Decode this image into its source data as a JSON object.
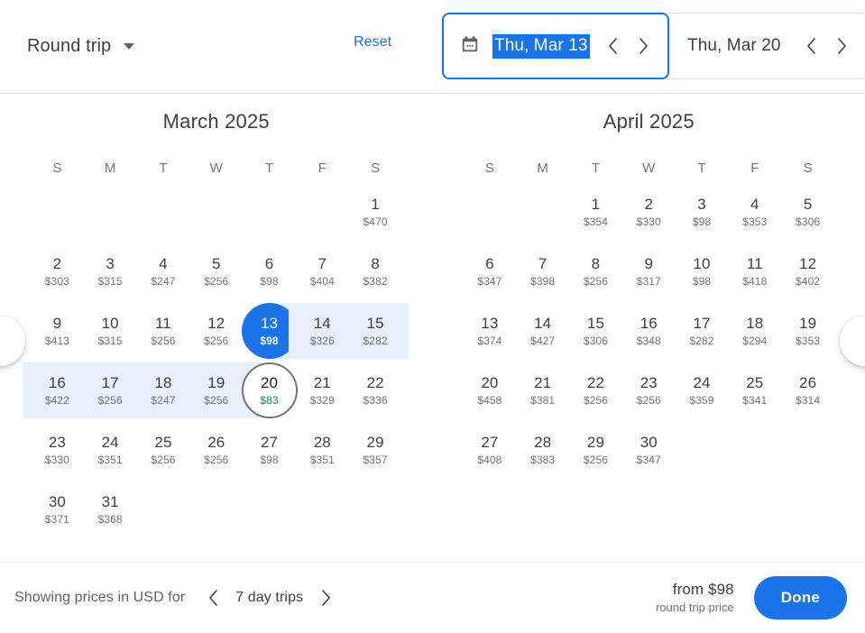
{
  "header": {
    "trip_type": "Round trip",
    "reset_label": "Reset",
    "depart": {
      "value": "Thu, Mar 13",
      "icon": "calendar-icon"
    },
    "return": {
      "value": "Thu, Mar 20"
    },
    "prev_icon": "chevron-left-icon",
    "next_icon": "chevron-right-icon"
  },
  "weekdays": [
    "S",
    "M",
    "T",
    "W",
    "T",
    "F",
    "S"
  ],
  "months": [
    {
      "title": "March 2025",
      "lead_blanks": 6,
      "days": [
        {
          "day": "1",
          "price": "$470"
        },
        {
          "day": "2",
          "price": "$303"
        },
        {
          "day": "3",
          "price": "$315"
        },
        {
          "day": "4",
          "price": "$247"
        },
        {
          "day": "5",
          "price": "$256"
        },
        {
          "day": "6",
          "price": "$98"
        },
        {
          "day": "7",
          "price": "$404"
        },
        {
          "day": "8",
          "price": "$382"
        },
        {
          "day": "9",
          "price": "$413"
        },
        {
          "day": "10",
          "price": "$315"
        },
        {
          "day": "11",
          "price": "$256"
        },
        {
          "day": "12",
          "price": "$256"
        },
        {
          "day": "13",
          "price": "$98",
          "state": "selected-start"
        },
        {
          "day": "14",
          "price": "$326",
          "state": "in-range"
        },
        {
          "day": "15",
          "price": "$282",
          "state": "in-range"
        },
        {
          "day": "16",
          "price": "$422",
          "state": "in-range"
        },
        {
          "day": "17",
          "price": "$256",
          "state": "in-range"
        },
        {
          "day": "18",
          "price": "$247",
          "state": "in-range"
        },
        {
          "day": "19",
          "price": "$256",
          "state": "in-range"
        },
        {
          "day": "20",
          "price": "$83",
          "state": "selected-end",
          "price_low": true
        },
        {
          "day": "21",
          "price": "$329"
        },
        {
          "day": "22",
          "price": "$336"
        },
        {
          "day": "23",
          "price": "$330"
        },
        {
          "day": "24",
          "price": "$351"
        },
        {
          "day": "25",
          "price": "$256"
        },
        {
          "day": "26",
          "price": "$256"
        },
        {
          "day": "27",
          "price": "$98"
        },
        {
          "day": "28",
          "price": "$351"
        },
        {
          "day": "29",
          "price": "$357"
        },
        {
          "day": "30",
          "price": "$371"
        },
        {
          "day": "31",
          "price": "$368"
        }
      ]
    },
    {
      "title": "April 2025",
      "lead_blanks": 2,
      "days": [
        {
          "day": "1",
          "price": "$354"
        },
        {
          "day": "2",
          "price": "$330"
        },
        {
          "day": "3",
          "price": "$98"
        },
        {
          "day": "4",
          "price": "$353"
        },
        {
          "day": "5",
          "price": "$306"
        },
        {
          "day": "6",
          "price": "$347"
        },
        {
          "day": "7",
          "price": "$398"
        },
        {
          "day": "8",
          "price": "$256"
        },
        {
          "day": "9",
          "price": "$317"
        },
        {
          "day": "10",
          "price": "$98"
        },
        {
          "day": "11",
          "price": "$418"
        },
        {
          "day": "12",
          "price": "$402"
        },
        {
          "day": "13",
          "price": "$374"
        },
        {
          "day": "14",
          "price": "$427"
        },
        {
          "day": "15",
          "price": "$306"
        },
        {
          "day": "16",
          "price": "$348"
        },
        {
          "day": "17",
          "price": "$282"
        },
        {
          "day": "18",
          "price": "$294"
        },
        {
          "day": "19",
          "price": "$353"
        },
        {
          "day": "20",
          "price": "$458"
        },
        {
          "day": "21",
          "price": "$381"
        },
        {
          "day": "22",
          "price": "$256"
        },
        {
          "day": "23",
          "price": "$256"
        },
        {
          "day": "24",
          "price": "$359"
        },
        {
          "day": "25",
          "price": "$341"
        },
        {
          "day": "26",
          "price": "$314"
        },
        {
          "day": "27",
          "price": "$408"
        },
        {
          "day": "28",
          "price": "$383"
        },
        {
          "day": "29",
          "price": "$256"
        },
        {
          "day": "30",
          "price": "$347"
        }
      ]
    }
  ],
  "nav": {
    "scroll_left_icon": "scroll-left-icon",
    "scroll_right_icon": "scroll-right-icon"
  },
  "footer": {
    "showing_text": "Showing prices in USD for",
    "trip_length": "7 day trips",
    "from_price": "from $98",
    "price_sub": "round trip price",
    "done_label": "Done"
  },
  "colors": {
    "accent": "#1a73e8",
    "range_band": "#e8f0fe",
    "low_price": "#0d904f",
    "text": "#3c4043",
    "muted": "#70757a"
  }
}
